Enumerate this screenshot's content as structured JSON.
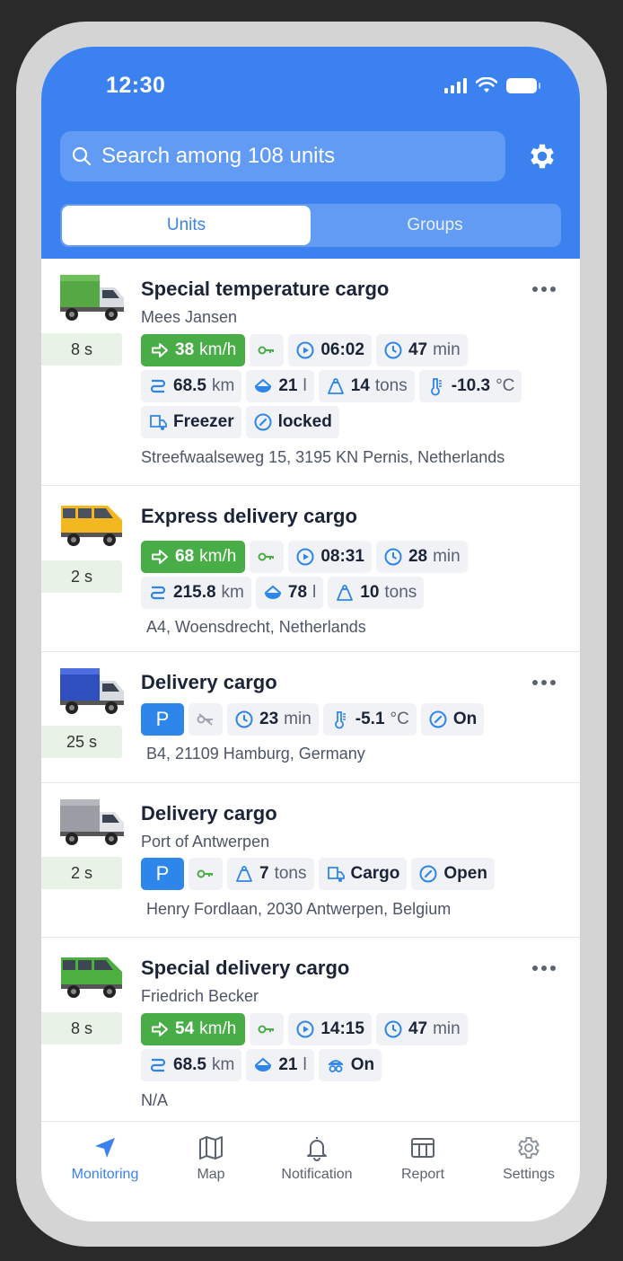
{
  "status_bar": {
    "time": "12:30"
  },
  "search": {
    "placeholder": "Search among 108 units"
  },
  "tabs": {
    "units": "Units",
    "groups": "Groups"
  },
  "units": [
    {
      "title": "Special temperature cargo",
      "subtitle": "Mees Jansen",
      "elapsed": "8 s",
      "vehicle": "green truck",
      "speed": "38",
      "speed_unit": "km/h",
      "time": "06:02",
      "duration": "47",
      "duration_unit": "min",
      "distance": "68.5",
      "distance_unit": "km",
      "fuel": "21",
      "fuel_unit": "l",
      "weight": "14",
      "weight_unit": "tons",
      "temperature": "-10.3",
      "temp_unit": "°C",
      "trailer": "Freezer",
      "lock": "locked",
      "address": "Streefwaalseweg 15, 3195 KN Pernis, Netherlands"
    },
    {
      "title": "Express delivery cargo",
      "elapsed": "2 s",
      "vehicle": "yellow van",
      "speed": "68",
      "speed_unit": "km/h",
      "time": "08:31",
      "duration": "28",
      "duration_unit": "min",
      "distance": "215.8",
      "distance_unit": "km",
      "fuel": "78",
      "fuel_unit": "l",
      "weight": "10",
      "weight_unit": "tons",
      "address": "A4, Woensdrecht, Netherlands"
    },
    {
      "title": "Delivery cargo",
      "elapsed": "25 s",
      "vehicle": "blue truck",
      "parking": "P",
      "duration": "23",
      "duration_unit": "min",
      "temperature": "-5.1",
      "temp_unit": "°C",
      "door": "On",
      "address": "B4, 21109 Hamburg, Germany"
    },
    {
      "title": "Delivery cargo",
      "subtitle": "Port of Antwerpen",
      "elapsed": "2 s",
      "vehicle": "grey truck",
      "parking": "P",
      "weight": "7",
      "weight_unit": "tons",
      "trailer": "Cargo",
      "door": "Open",
      "address": "Henry Fordlaan, 2030 Antwerpen, Belgium"
    },
    {
      "title": "Special delivery cargo",
      "subtitle": "Friedrich Becker",
      "elapsed": "8 s",
      "vehicle": "green van",
      "speed": "54",
      "speed_unit": "km/h",
      "time": "14:15",
      "duration": "47",
      "duration_unit": "min",
      "distance": "68.5",
      "distance_unit": "km",
      "fuel": "21",
      "fuel_unit": "l",
      "driver_status": "On",
      "address": "N/A"
    }
  ],
  "tabbar": [
    {
      "label": "Monitoring",
      "icon": "navigation-arrow-icon"
    },
    {
      "label": "Map",
      "icon": "map-icon"
    },
    {
      "label": "Notification",
      "icon": "bell-icon"
    },
    {
      "label": "Report",
      "icon": "table-icon"
    },
    {
      "label": "Settings",
      "icon": "gear-icon"
    }
  ],
  "colors": {
    "primary": "#3b82f0",
    "speed": "#49ad47",
    "parking": "#2f86ea",
    "elapsed_bg": "#e9f2e6"
  }
}
